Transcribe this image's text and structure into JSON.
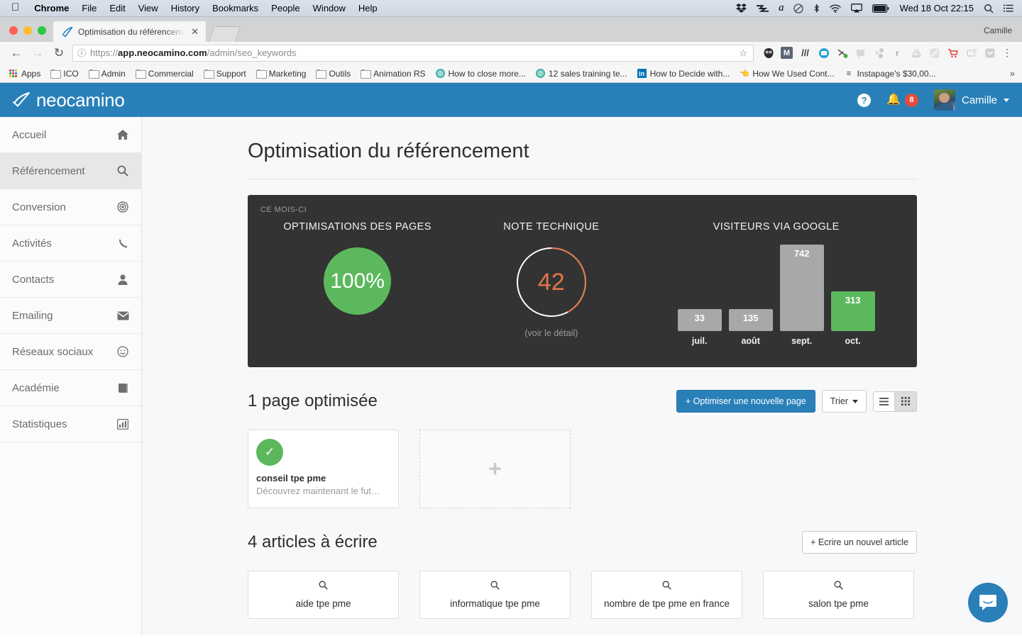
{
  "os_menu": {
    "apple_icon": "apple-icon",
    "items": [
      "Chrome",
      "File",
      "Edit",
      "View",
      "History",
      "Bookmarks",
      "People",
      "Window",
      "Help"
    ],
    "status_icons": [
      "dropbox-icon",
      "transmit-icon",
      "alfred-icon",
      "do-not-disturb-icon",
      "bluetooth-icon",
      "wifi-icon",
      "airplay-icon",
      "battery-icon"
    ],
    "clock": "Wed 18 Oct  22:15",
    "search_icon": "spotlight-search-icon",
    "notification_icon": "notification-center-icon"
  },
  "browser": {
    "tab": {
      "title": "Optimisation du référencement",
      "favicon": "neocamino-feather-favicon",
      "close_icon": "close-icon"
    },
    "new_tab_label": "",
    "profile_name": "Camille",
    "nav": {
      "back_icon": "back-arrow-icon",
      "forward_icon": "forward-arrow-icon",
      "reload_icon": "reload-icon"
    },
    "omnibox": {
      "info_icon": "site-info-icon",
      "url_scheme": "https://",
      "url_host": "app.neocamino.com",
      "url_path": "/admin/seo_keywords",
      "star_icon": "bookmark-star-icon"
    },
    "extensions": [
      "owl-icon",
      "mailtrack-icon",
      "slashes-icon",
      "intercom-icon",
      "hunter-icon",
      "quote-icon",
      "boomerang-icon",
      "r-icon",
      "drive-icon",
      "datanyze-icon",
      "cart-icon",
      "mixmax-icon",
      "pocket-icon"
    ],
    "menu_icon": "chrome-menu-icon",
    "bookmarks": [
      {
        "label": "Apps",
        "icon": "apps-grid-icon"
      },
      {
        "label": "ICO",
        "icon": "folder-icon"
      },
      {
        "label": "Admin",
        "icon": "folder-icon"
      },
      {
        "label": "Commercial",
        "icon": "folder-icon"
      },
      {
        "label": "Support",
        "icon": "folder-icon"
      },
      {
        "label": "Marketing",
        "icon": "folder-icon"
      },
      {
        "label": "Outils",
        "icon": "folder-icon"
      },
      {
        "label": "Animation RS",
        "icon": "folder-icon"
      },
      {
        "label": "How to close more...",
        "icon": "teal-circle-icon"
      },
      {
        "label": "12 sales training te...",
        "icon": "teal-circle-icon"
      },
      {
        "label": "How to Decide with...",
        "icon": "linkedin-icon"
      },
      {
        "label": "How We Used Cont...",
        "icon": "hand-icon"
      },
      {
        "label": "Instapage's $30,00...",
        "icon": "instapage-icon"
      }
    ],
    "bookmarks_overflow_icon": "chevron-double-right-icon"
  },
  "app": {
    "brand": "neocamino",
    "brand_icon": "feather-check-logo",
    "header": {
      "help_icon": "help-question-icon",
      "bell_icon": "bell-icon",
      "notifications_count": "8",
      "user_name": "Camille",
      "avatar": "user-avatar",
      "caret_icon": "chevron-down-icon"
    },
    "sidebar": [
      {
        "label": "Accueil",
        "icon": "home-icon",
        "active": false
      },
      {
        "label": "Référencement",
        "icon": "search-icon",
        "active": true
      },
      {
        "label": "Conversion",
        "icon": "target-icon",
        "active": false
      },
      {
        "label": "Activités",
        "icon": "phone-icon",
        "active": false
      },
      {
        "label": "Contacts",
        "icon": "user-icon",
        "active": false
      },
      {
        "label": "Emailing",
        "icon": "envelope-icon",
        "active": false
      },
      {
        "label": "Réseaux sociaux",
        "icon": "smiley-icon",
        "active": false
      },
      {
        "label": "Académie",
        "icon": "book-icon",
        "active": false
      },
      {
        "label": "Statistiques",
        "icon": "bar-chart-icon",
        "active": false
      }
    ],
    "page_title": "Optimisation du référencement",
    "stats": {
      "period_label": "CE MOIS-CI",
      "pages": {
        "title": "OPTIMISATIONS DES PAGES",
        "value": "100%"
      },
      "technical": {
        "title": "NOTE TECHNIQUE",
        "value": "42",
        "detail_link": "(voir le détail)"
      },
      "visitors": {
        "title": "VISITEURS VIA GOOGLE"
      }
    },
    "pages_section": {
      "title": "1 page optimisée",
      "primary_button": "+ Optimiser une nouvelle page",
      "sort_button": "Trier",
      "list_view_icon": "list-view-icon",
      "grid_view_icon": "grid-view-icon",
      "cards": [
        {
          "title": "conseil tpe pme",
          "desc": "Découvrez maintenant le fut…",
          "status_icon": "check-icon"
        }
      ],
      "add_card_icon": "plus-icon"
    },
    "articles_section": {
      "title": "4 articles à écrire",
      "button": "+ Ecrire un nouvel article",
      "keywords": [
        {
          "label": "aide tpe pme",
          "icon": "search-icon"
        },
        {
          "label": "informatique tpe pme",
          "icon": "search-icon"
        },
        {
          "label": "nombre de tpe pme en france",
          "icon": "search-icon"
        },
        {
          "label": "salon tpe pme",
          "icon": "search-icon"
        }
      ]
    },
    "intercom_icon": "intercom-chat-icon",
    "colors": {
      "brand_blue": "#2980b9",
      "green": "#5cb85c",
      "orange": "#e0764a",
      "panel_dark": "#333333",
      "badge_red": "#e74c3c",
      "bar_grey": "#a8a8a8"
    }
  },
  "chart_data": {
    "type": "bar",
    "title": "VISITEURS VIA GOOGLE",
    "categories": [
      "juil.",
      "août",
      "sept.",
      "oct."
    ],
    "values": [
      33,
      135,
      742,
      313
    ],
    "bar_colors": [
      "#a8a8a8",
      "#a8a8a8",
      "#a8a8a8",
      "#5cb85c"
    ],
    "xlabel": "",
    "ylabel": "",
    "ylim": [
      0,
      742
    ],
    "grid": false,
    "legend": false,
    "data_labels": [
      "33",
      "135",
      "742",
      "313"
    ],
    "gauge": {
      "type": "donut",
      "label": "NOTE TECHNIQUE",
      "value": 42,
      "max": 100,
      "color": "#e0764a",
      "track_color": "#ffffff"
    },
    "progress": {
      "type": "circle",
      "label": "OPTIMISATIONS DES PAGES",
      "value": 100,
      "unit": "%",
      "color": "#5cb85c"
    }
  }
}
